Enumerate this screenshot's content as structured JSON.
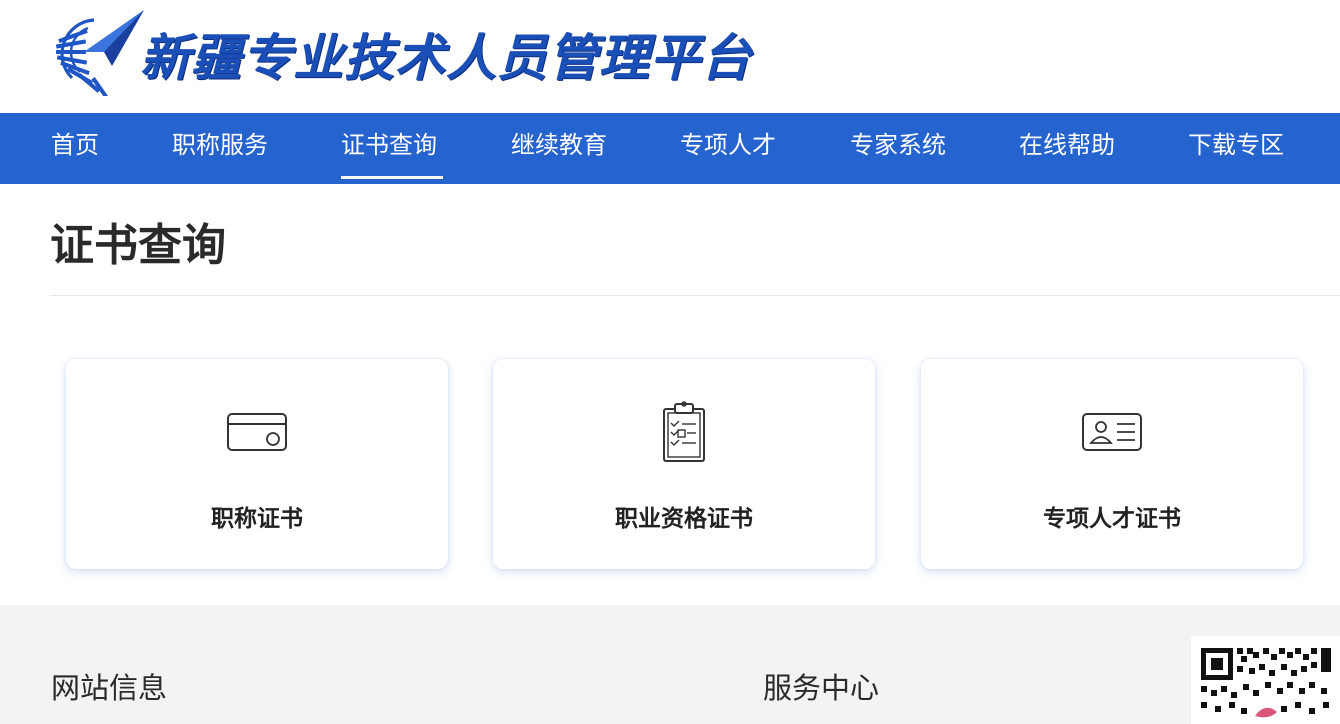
{
  "header": {
    "site_title": "新疆专业技术人员管理平台",
    "brand_color": "#1b4fb8",
    "logo_icon": "paper-plane-logo-icon"
  },
  "nav": {
    "color": "#2563cf",
    "active_index": 2,
    "items": [
      {
        "label": "首页"
      },
      {
        "label": "职称服务"
      },
      {
        "label": "证书查询"
      },
      {
        "label": "继续教育"
      },
      {
        "label": "专项人才"
      },
      {
        "label": "专家系统"
      },
      {
        "label": "在线帮助"
      },
      {
        "label": "下载专区"
      }
    ]
  },
  "main": {
    "title": "证书查询",
    "cards": [
      {
        "label": "职称证书",
        "icon": "card-icon"
      },
      {
        "label": "职业资格证书",
        "icon": "clipboard-checklist-icon"
      },
      {
        "label": "专项人才证书",
        "icon": "id-card-icon"
      }
    ]
  },
  "footer": {
    "site_info_heading": "网站信息",
    "service_center_heading": "服务中心",
    "qr_icon": "qr-code-icon"
  }
}
